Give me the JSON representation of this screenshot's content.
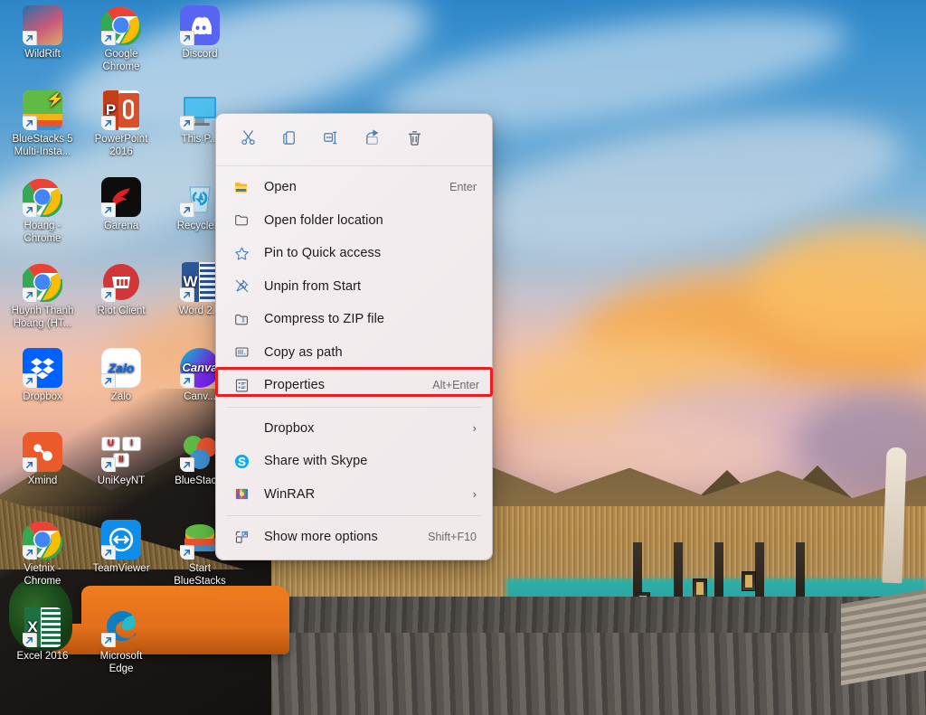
{
  "desktop": {
    "wallpaper_description": "Maldives overwater bungalow resort at sunset",
    "icons": [
      {
        "name": "WildRift",
        "label": "WildRift",
        "icon": "wildrift-icon",
        "col": 0,
        "row": 0
      },
      {
        "name": "Google Chrome",
        "label": "Google\nChrome",
        "icon": "chrome-icon",
        "col": 1,
        "row": 0
      },
      {
        "name": "Discord",
        "label": "Discord",
        "icon": "discord-icon",
        "col": 2,
        "row": 0
      },
      {
        "name": "BlueStacks 5 Multi",
        "label": "BlueStacks 5\nMulti-Insta...",
        "icon": "bluestacks-icon",
        "col": 0,
        "row": 1
      },
      {
        "name": "PowerPoint 2016",
        "label": "PowerPoint\n2016",
        "icon": "powerpoint-icon",
        "col": 1,
        "row": 1
      },
      {
        "name": "This PC",
        "label": "This P...",
        "icon": "this-pc-icon",
        "col": 2,
        "row": 1
      },
      {
        "name": "Hoang Chrome",
        "label": "Hoang -\nChrome",
        "icon": "chrome-icon",
        "col": 0,
        "row": 2
      },
      {
        "name": "Garena",
        "label": "Garena",
        "icon": "garena-icon",
        "col": 1,
        "row": 2
      },
      {
        "name": "Recycle Bin",
        "label": "Recycle...",
        "icon": "recycle-bin-icon",
        "col": 2,
        "row": 2
      },
      {
        "name": "Huynh Thanh Hoang",
        "label": "Huynh Thanh\nHoang (HT...",
        "icon": "chrome-icon",
        "col": 0,
        "row": 3
      },
      {
        "name": "Riot Client",
        "label": "Riot Client",
        "icon": "riot-icon",
        "col": 1,
        "row": 3
      },
      {
        "name": "Word 2016",
        "label": "Word 2...",
        "icon": "word-icon",
        "col": 2,
        "row": 3
      },
      {
        "name": "Dropbox",
        "label": "Dropbox",
        "icon": "dropbox-icon",
        "col": 0,
        "row": 4
      },
      {
        "name": "Zalo",
        "label": "Zalo",
        "icon": "zalo-icon",
        "col": 1,
        "row": 4
      },
      {
        "name": "Canva",
        "label": "Canv...",
        "icon": "canva-icon",
        "col": 2,
        "row": 4
      },
      {
        "name": "Xmind",
        "label": "Xmind",
        "icon": "xmind-icon",
        "col": 0,
        "row": 5
      },
      {
        "name": "UniKeyNT",
        "label": "UniKeyNT",
        "icon": "unikey-icon",
        "col": 1,
        "row": 5
      },
      {
        "name": "BlueStacks",
        "label": "BlueStac...",
        "icon": "bluestacks-x-icon",
        "col": 2,
        "row": 5
      },
      {
        "name": "Vietnix Chrome",
        "label": "Vietnix -\nChrome",
        "icon": "chrome-icon",
        "col": 0,
        "row": 6
      },
      {
        "name": "TeamViewer",
        "label": "TeamViewer",
        "icon": "teamviewer-icon",
        "col": 1,
        "row": 6
      },
      {
        "name": "Start BlueStacks",
        "label": "Start\nBlueStacks",
        "icon": "bluestacks-s-icon",
        "col": 2,
        "row": 6
      },
      {
        "name": "Excel 2016",
        "label": "Excel 2016",
        "icon": "excel-icon",
        "col": 0,
        "row": 7
      },
      {
        "name": "Microsoft Edge",
        "label": "Microsoft\nEdge",
        "icon": "edge-icon",
        "col": 1,
        "row": 7
      }
    ]
  },
  "context_menu": {
    "toolbar": [
      {
        "name": "cut",
        "icon": "scissors-icon",
        "tooltip": "Cut"
      },
      {
        "name": "copy",
        "icon": "copy-icon",
        "tooltip": "Copy"
      },
      {
        "name": "rename",
        "icon": "rename-icon",
        "tooltip": "Rename"
      },
      {
        "name": "share",
        "icon": "share-icon",
        "tooltip": "Share"
      },
      {
        "name": "delete",
        "icon": "trash-icon",
        "tooltip": "Delete"
      }
    ],
    "items": [
      {
        "label": "Open",
        "accel": "Enter",
        "icon": "folder-open-icon",
        "submenu": false,
        "highlighted": false,
        "divider_after": false
      },
      {
        "label": "Open folder location",
        "accel": "",
        "icon": "folder-icon",
        "submenu": false,
        "highlighted": false,
        "divider_after": false
      },
      {
        "label": "Pin to Quick access",
        "accel": "",
        "icon": "star-icon",
        "submenu": false,
        "highlighted": false,
        "divider_after": false
      },
      {
        "label": "Unpin from Start",
        "accel": "",
        "icon": "unpin-icon",
        "submenu": false,
        "highlighted": false,
        "divider_after": false
      },
      {
        "label": "Compress to ZIP file",
        "accel": "",
        "icon": "zip-icon",
        "submenu": false,
        "highlighted": false,
        "divider_after": false
      },
      {
        "label": "Copy as path",
        "accel": "",
        "icon": "copy-path-icon",
        "submenu": false,
        "highlighted": false,
        "divider_after": false
      },
      {
        "label": "Properties",
        "accel": "Alt+Enter",
        "icon": "properties-icon",
        "submenu": false,
        "highlighted": true,
        "divider_after": true
      },
      {
        "label": "Dropbox",
        "accel": "",
        "icon": "none",
        "submenu": true,
        "highlighted": false,
        "divider_after": false
      },
      {
        "label": "Share with Skype",
        "accel": "",
        "icon": "skype-icon",
        "submenu": false,
        "highlighted": false,
        "divider_after": false
      },
      {
        "label": "WinRAR",
        "accel": "",
        "icon": "winrar-icon",
        "submenu": true,
        "highlighted": false,
        "divider_after": true
      },
      {
        "label": "Show more options",
        "accel": "Shift+F10",
        "icon": "more-options-icon",
        "submenu": false,
        "highlighted": false,
        "divider_after": false
      }
    ]
  },
  "colors": {
    "highlight_red": "#ee1c1c",
    "menu_background": "#f2ecee",
    "menu_text": "#1b1b1b",
    "accel_text": "#6b6b6b",
    "icon_blue": "#3f7fc1"
  }
}
